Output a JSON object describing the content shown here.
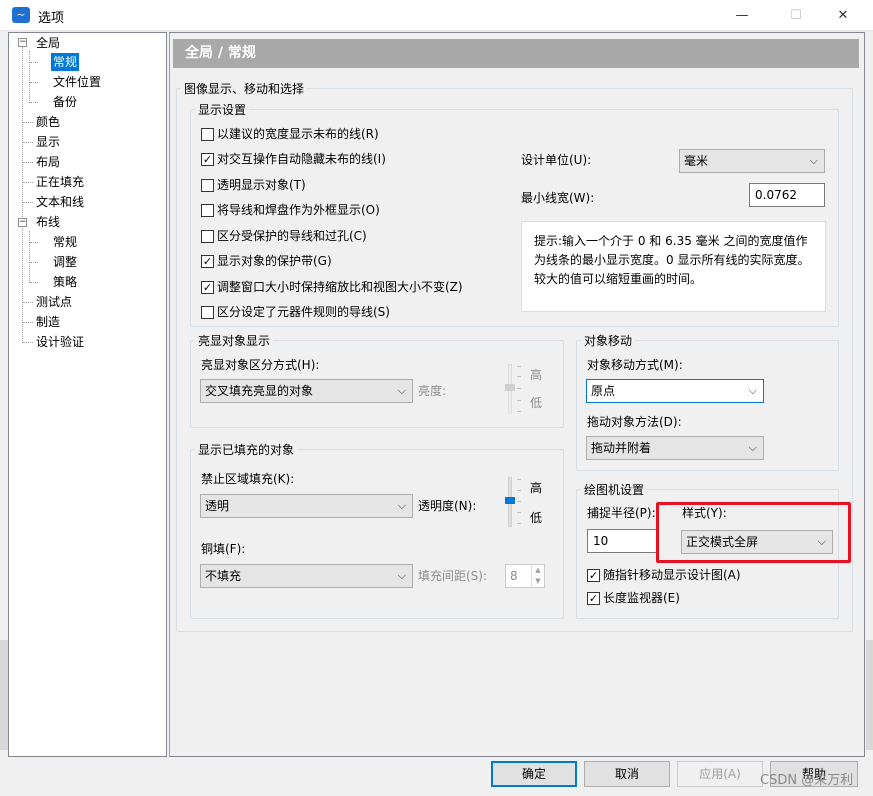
{
  "window": {
    "title": "选项",
    "controls": {
      "minimize": "—",
      "maximize": "☐",
      "close": "✕"
    }
  },
  "tree": {
    "items": [
      {
        "label": "全局",
        "toggle": "−"
      },
      {
        "label": "常规"
      },
      {
        "label": "文件位置"
      },
      {
        "label": "备份"
      },
      {
        "label": "颜色"
      },
      {
        "label": "显示"
      },
      {
        "label": "布局"
      },
      {
        "label": "正在填充"
      },
      {
        "label": "文本和线"
      },
      {
        "label": "布线",
        "toggle": "−"
      },
      {
        "label": "常规"
      },
      {
        "label": "调整"
      },
      {
        "label": "策略"
      },
      {
        "label": "测试点"
      },
      {
        "label": "制造"
      },
      {
        "label": "设计验证"
      }
    ]
  },
  "page": {
    "header": "全局 / 常规"
  },
  "image_group": {
    "label": "图像显示、移动和选择"
  },
  "display_settings": {
    "label": "显示设置",
    "checkboxes": [
      {
        "label": "以建议的宽度显示未布的线(R)",
        "checked": false
      },
      {
        "label": "对交互操作自动隐藏未布的线(I)",
        "checked": true
      },
      {
        "label": "透明显示对象(T)",
        "checked": false
      },
      {
        "label": "将导线和焊盘作为外框显示(O)",
        "checked": false
      },
      {
        "label": "区分受保护的导线和过孔(C)",
        "checked": false
      },
      {
        "label": "显示对象的保护带(G)",
        "checked": true
      },
      {
        "label": "调整窗口大小时保持缩放比和视图大小不变(Z)",
        "checked": true
      },
      {
        "label": "区分设定了元器件规则的导线(S)",
        "checked": false
      }
    ],
    "check_glyph": "✓",
    "design_unit_label": "设计单位(U):",
    "design_unit_value": "毫米",
    "min_width_label": "最小线宽(W):",
    "min_width_value": "0.0762",
    "hint_lines": [
      "提示:输入一个介于 0 和 6.35 毫米 之间的宽度值作",
      "为线条的最小显示宽度。0 显示所有线的实际宽度。",
      "较大的值可以缩短重画的时间。"
    ]
  },
  "highlight": {
    "label": "亮显对象显示",
    "mode_label": "亮显对象区分方式(H):",
    "mode_value": "交叉填充亮显的对象",
    "brightness_label": "亮度:",
    "high": "高",
    "low": "低"
  },
  "object_move": {
    "label": "对象移动",
    "mode_label": "对象移动方式(M):",
    "mode_value": "原点",
    "drag_label": "拖动对象方法(D):",
    "drag_value": "拖动并附着"
  },
  "filled": {
    "label": "显示已填充的对象",
    "keepout_label": "禁止区域填充(K):",
    "keepout_value": "透明",
    "transparency_label": "透明度(N):",
    "high": "高",
    "low": "低",
    "copper_label": "铜填(F):",
    "copper_value": "不填充",
    "spacing_label": "填充间距(S):",
    "spacing_value": "8",
    "spin_up": "▲",
    "spin_down": "▼"
  },
  "plotter": {
    "label": "绘图机设置",
    "snap_label": "捕捉半径(P):",
    "snap_value": "10",
    "style_label": "样式(Y):",
    "style_value": "正交模式全屏",
    "follow_label": "随指针移动显示设计图(A)",
    "follow_checked": true,
    "length_label": "长度监视器(E)",
    "length_checked": true
  },
  "buttons": {
    "ok": "确定",
    "cancel": "取消",
    "apply": "应用(A)",
    "help": "帮助"
  },
  "dropdown_arrow": "⌵",
  "watermark": "CSDN @来万利"
}
